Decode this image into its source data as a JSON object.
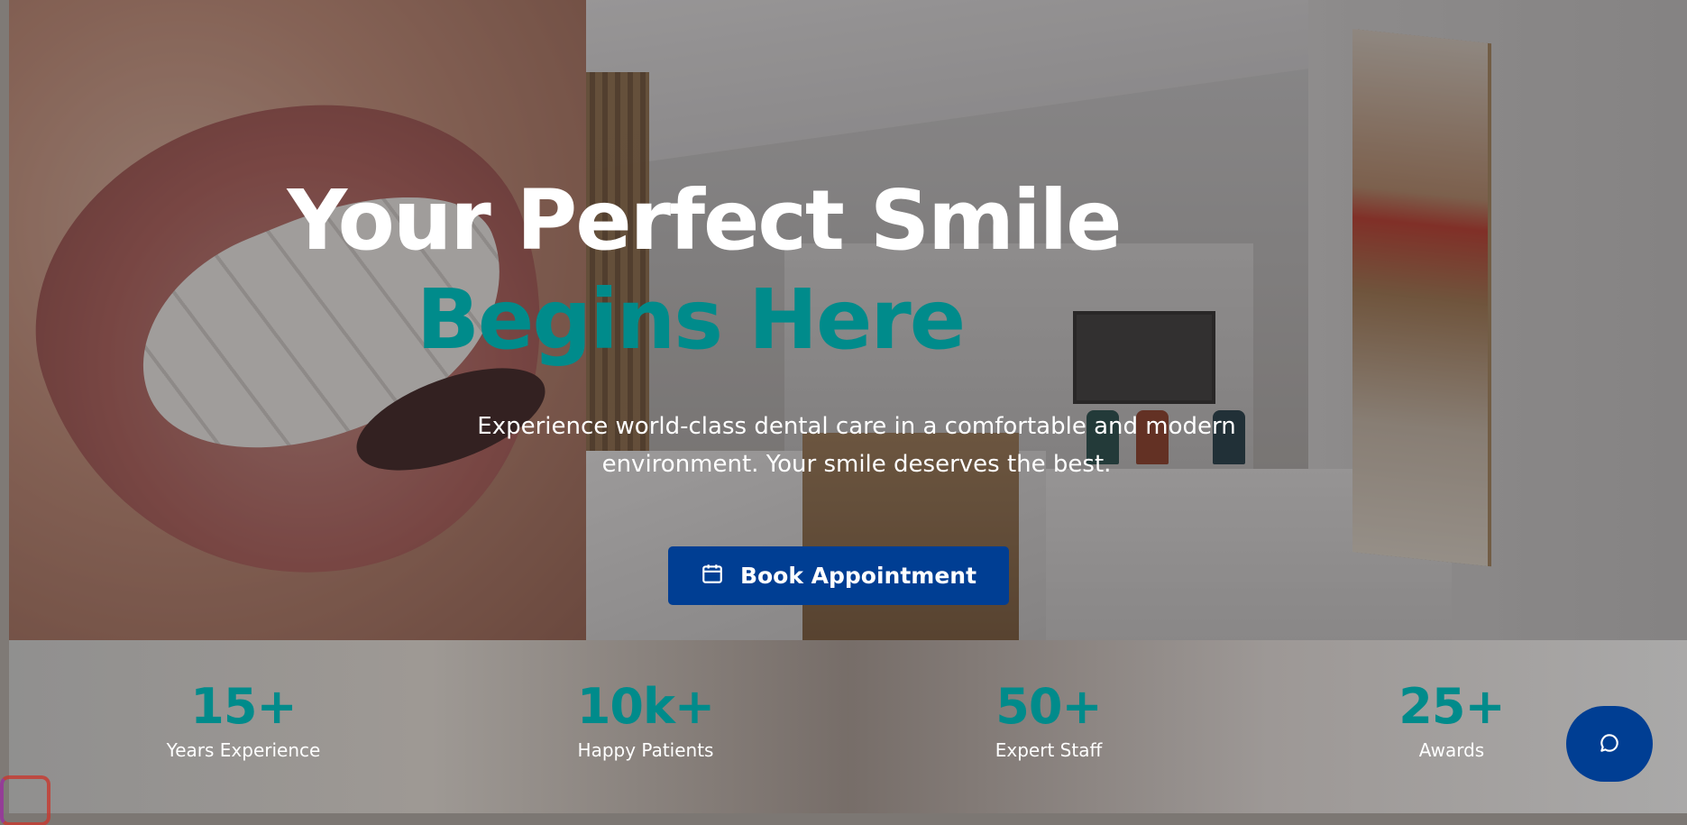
{
  "hero": {
    "title_line1": "Your Perfect Smile",
    "title_line2": "Begins Here",
    "subtitle": "Experience world-class dental care in a comfortable and modern environment. Your smile deserves the best.",
    "cta_label": "Book Appointment",
    "cta_icon": "calendar-icon",
    "accent_color": "#008b8b",
    "button_color": "#003e93"
  },
  "stats": [
    {
      "value": "15+",
      "label": "Years Experience"
    },
    {
      "value": "10k+",
      "label": "Happy Patients"
    },
    {
      "value": "50+",
      "label": "Expert Staff"
    },
    {
      "value": "25+",
      "label": "Awards"
    }
  ],
  "chat": {
    "icon": "chat-bubble-icon"
  }
}
